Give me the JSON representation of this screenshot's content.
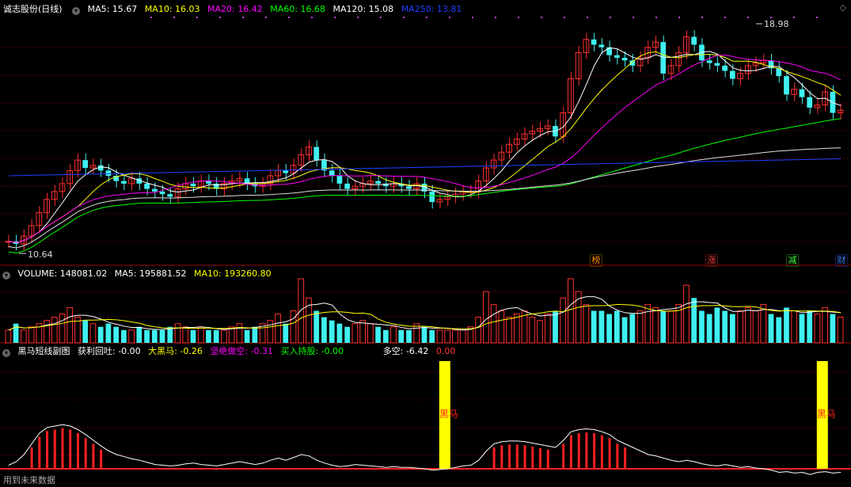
{
  "header": {
    "stock_name": "诚志股份(日线)",
    "ma": [
      {
        "label": "MA5: 15.67",
        "color": "#ffffff"
      },
      {
        "label": "MA10: 16.03",
        "color": "#ffff00"
      },
      {
        "label": "MA20: 16.42",
        "color": "#ff00ff"
      },
      {
        "label": "MA60: 16.68",
        "color": "#00ff00"
      },
      {
        "label": "MA120: 15.08",
        "color": "#ffffff"
      },
      {
        "label": "MA250: 13.81",
        "color": "#0000ff"
      }
    ]
  },
  "volume_header": {
    "title": "VOLUME: 148081.02",
    "ma5": "MA5: 195881.52",
    "ma10": "MA10: 193260.80"
  },
  "indicator_header": {
    "title": "黑马短线副图",
    "items": [
      {
        "label": "获利回吐: -0.00",
        "color": "#ffffff"
      },
      {
        "label": "大黑马: -0.26",
        "color": "#ffff00"
      },
      {
        "label": "坚绝做空: -0.31",
        "color": "#ff00ff"
      },
      {
        "label": "买入持股: -0.00",
        "color": "#00ff00"
      },
      {
        "label": "多空: -6.42",
        "color": "#ffffff"
      },
      {
        "label": "0.00",
        "color": "#ff3333"
      }
    ]
  },
  "price_labels": {
    "high": "18.98",
    "low": "10.64"
  },
  "event_tags": [
    {
      "text": "榜",
      "color": "#ff8800"
    },
    {
      "text": "涨",
      "color": "#ff4040"
    },
    {
      "text": "减",
      "color": "#40ff40"
    },
    {
      "text": "财",
      "color": "#4080ff"
    }
  ],
  "signal_label": "黑马",
  "footer": "用到未来数据",
  "icons": {
    "collapse": "circle-collapse-icon",
    "corner": "diamond-icon"
  },
  "chart_data": {
    "type": "candlestick",
    "title": "诚志股份(日线)",
    "price": {
      "high": 18.98,
      "low": 10.64,
      "close_series": [
        10.7,
        10.6,
        10.9,
        11.3,
        11.8,
        12.3,
        12.6,
        12.9,
        13.4,
        13.8,
        13.5,
        13.6,
        13.4,
        13.2,
        13.0,
        12.9,
        13.1,
        12.9,
        12.7,
        12.6,
        12.5,
        12.4,
        12.7,
        12.9,
        12.8,
        13.0,
        12.9,
        12.7,
        12.9,
        13.0,
        13.1,
        12.9,
        12.8,
        12.9,
        13.2,
        13.4,
        13.3,
        13.6,
        14.0,
        14.3,
        13.8,
        13.4,
        13.2,
        12.9,
        12.7,
        12.8,
        12.9,
        13.0,
        12.9,
        12.8,
        12.9,
        12.8,
        12.7,
        12.9,
        12.6,
        12.2,
        12.3,
        12.4,
        12.5,
        12.6,
        12.6,
        13.0,
        13.5,
        13.8,
        14.1,
        14.4,
        14.6,
        14.8,
        14.9,
        15.0,
        15.1,
        14.7,
        15.6,
        16.9,
        17.9,
        18.4,
        18.2,
        18.1,
        17.8,
        17.7,
        17.6,
        17.4,
        17.7,
        18.1,
        18.3,
        17.1,
        17.4,
        17.9,
        18.5,
        18.2,
        17.6,
        17.5,
        17.4,
        17.2,
        16.9,
        17.1,
        17.4,
        17.5,
        17.6,
        17.3,
        17.0,
        16.3,
        16.5,
        16.2,
        15.8,
        15.9,
        16.4,
        15.6,
        15.7
      ]
    },
    "volume": {
      "current": 148081.02,
      "ma5": 195881.52,
      "ma10": 193260.8,
      "values": [
        0.2,
        0.3,
        0.2,
        0.25,
        0.3,
        0.35,
        0.4,
        0.45,
        0.55,
        0.4,
        0.35,
        0.3,
        0.25,
        0.3,
        0.25,
        0.2,
        0.2,
        0.25,
        0.2,
        0.2,
        0.2,
        0.25,
        0.3,
        0.25,
        0.2,
        0.25,
        0.2,
        0.2,
        0.2,
        0.25,
        0.3,
        0.2,
        0.25,
        0.3,
        0.35,
        0.45,
        0.3,
        0.5,
        1.0,
        0.7,
        0.5,
        0.4,
        0.35,
        0.3,
        0.25,
        0.3,
        0.35,
        0.3,
        0.25,
        0.2,
        0.25,
        0.2,
        0.2,
        0.3,
        0.25,
        0.2,
        0.2,
        0.2,
        0.2,
        0.2,
        0.25,
        0.4,
        0.8,
        0.6,
        0.5,
        0.4,
        0.45,
        0.5,
        0.4,
        0.35,
        0.45,
        0.5,
        0.7,
        1.0,
        0.8,
        0.6,
        0.5,
        0.5,
        0.45,
        0.5,
        0.4,
        0.45,
        0.5,
        0.6,
        0.55,
        0.5,
        0.5,
        0.6,
        0.9,
        0.7,
        0.5,
        0.45,
        0.55,
        0.5,
        0.45,
        0.5,
        0.55,
        0.5,
        0.6,
        0.45,
        0.4,
        0.55,
        0.5,
        0.45,
        0.5,
        0.45,
        0.55,
        0.45,
        0.4
      ]
    },
    "indicator": {
      "profit_taking": -0.0,
      "big_dark_horse": -0.26,
      "firm_short": -0.31,
      "buy_hold": -0.0,
      "long_short": -6.42,
      "line": [
        0.05,
        0.1,
        0.2,
        0.35,
        0.5,
        0.58,
        0.6,
        0.62,
        0.6,
        0.55,
        0.48,
        0.4,
        0.32,
        0.25,
        0.2,
        0.17,
        0.14,
        0.12,
        0.09,
        0.06,
        0.05,
        0.04,
        0.05,
        0.07,
        0.08,
        0.06,
        0.05,
        0.04,
        0.06,
        0.08,
        0.1,
        0.08,
        0.06,
        0.08,
        0.12,
        0.15,
        0.12,
        0.16,
        0.2,
        0.18,
        0.12,
        0.08,
        0.05,
        0.03,
        0.04,
        0.06,
        0.05,
        0.04,
        0.03,
        0.02,
        0.03,
        0.02,
        0.02,
        0.01,
        0.0,
        -0.02,
        -0.01,
        0.0,
        0.02,
        0.04,
        0.05,
        0.12,
        0.25,
        0.35,
        0.38,
        0.39,
        0.39,
        0.38,
        0.36,
        0.34,
        0.32,
        0.3,
        0.4,
        0.52,
        0.55,
        0.56,
        0.55,
        0.52,
        0.48,
        0.4,
        0.35,
        0.3,
        0.25,
        0.2,
        0.18,
        0.15,
        0.12,
        0.1,
        0.12,
        0.1,
        0.07,
        0.05,
        0.04,
        0.06,
        0.04,
        0.02,
        0.03,
        0.01,
        0.0,
        -0.02,
        -0.05,
        -0.04,
        -0.06,
        -0.05,
        -0.08,
        -0.05,
        -0.04,
        -0.06,
        -0.05
      ],
      "signals": [
        57,
        106
      ]
    }
  }
}
